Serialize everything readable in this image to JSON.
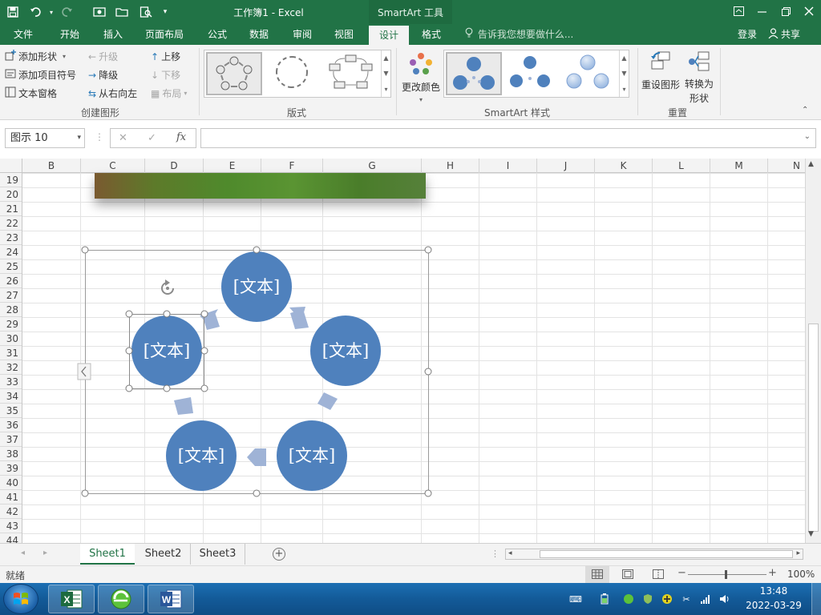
{
  "app": {
    "doc_title": "工作簿1 - Excel",
    "context_title": "SmartArt 工具"
  },
  "tabs": [
    {
      "label": "文件"
    },
    {
      "label": "开始"
    },
    {
      "label": "插入"
    },
    {
      "label": "页面布局"
    },
    {
      "label": "公式"
    },
    {
      "label": "数据"
    },
    {
      "label": "审阅"
    },
    {
      "label": "视图"
    },
    {
      "label": "设计"
    },
    {
      "label": "格式"
    }
  ],
  "tell_me": "告诉我您想要做什么...",
  "account": {
    "login": "登录",
    "share": "共享"
  },
  "ribbon": {
    "create": {
      "add_shape": "添加形状",
      "add_bullet": "添加项目符号",
      "text_pane": "文本窗格",
      "promote": "升级",
      "demote": "降级",
      "right_to_left": "从右向左",
      "move_up": "上移",
      "move_down": "下移",
      "layout": "布局",
      "group_label": "创建图形"
    },
    "layouts_label": "版式",
    "change_colors": "更改颜色",
    "styles_label": "SmartArt 样式",
    "reset": {
      "reset_graphic": "重设图形",
      "convert_line1": "转换为",
      "convert_line2": "形状",
      "group_label": "重置"
    }
  },
  "formula_bar": {
    "name_box": "图示 10",
    "cancel": "✕",
    "enter": "✓",
    "fx": "fx",
    "value": ""
  },
  "columns": [
    "B",
    "C",
    "D",
    "E",
    "F",
    "G",
    "H",
    "I",
    "J",
    "K",
    "L",
    "M",
    "N"
  ],
  "rows": [
    "19",
    "20",
    "21",
    "22",
    "23",
    "24",
    "25",
    "26",
    "27",
    "28",
    "29",
    "30",
    "31",
    "32",
    "33",
    "34",
    "35",
    "36",
    "37",
    "38",
    "39",
    "40",
    "41",
    "42",
    "43",
    "44"
  ],
  "smartart": {
    "nodes": [
      "[文本]",
      "[文本]",
      "[文本]",
      "[文本]",
      "[文本]"
    ],
    "node_color": "#4f81bd",
    "arrow_color": "#9fb3d6"
  },
  "sheets": [
    {
      "label": "Sheet1"
    },
    {
      "label": "Sheet2"
    },
    {
      "label": "Sheet3"
    }
  ],
  "status": {
    "ready": "就绪",
    "zoom": "100%"
  },
  "taskbar": {
    "time": "13:48",
    "date": "2022-03-29"
  },
  "colors": {
    "excel_green": "#217346",
    "smartart_blue": "#4f81bd"
  }
}
